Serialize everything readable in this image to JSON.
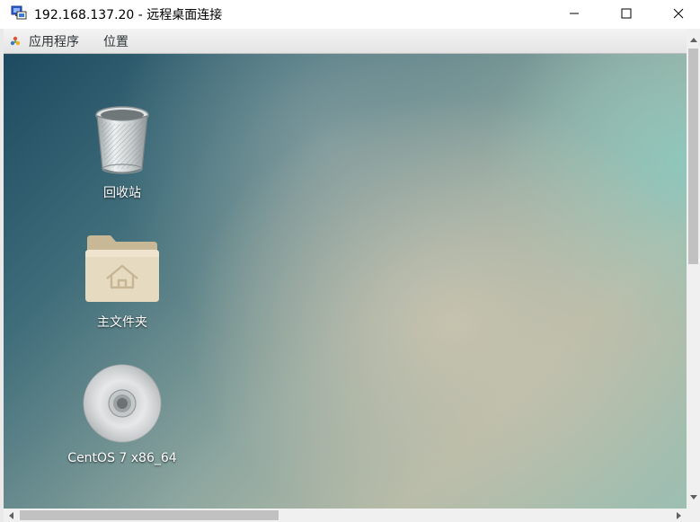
{
  "window": {
    "title": "192.168.137.20 - 远程桌面连接"
  },
  "gnome_panel": {
    "applications_label": "应用程序",
    "places_label": "位置"
  },
  "desktop_icons": [
    {
      "label": "回收站",
      "icon": "trash-icon"
    },
    {
      "label": "主文件夹",
      "icon": "home-folder-icon"
    },
    {
      "label": "CentOS 7 x86_64",
      "icon": "disc-icon"
    }
  ],
  "colors": {
    "title_bar": "#ffffff",
    "panel": "#ececec",
    "desktop_dark": "#1d4a60",
    "desktop_light": "#b5bba7",
    "folder": "#e5d8bd"
  }
}
